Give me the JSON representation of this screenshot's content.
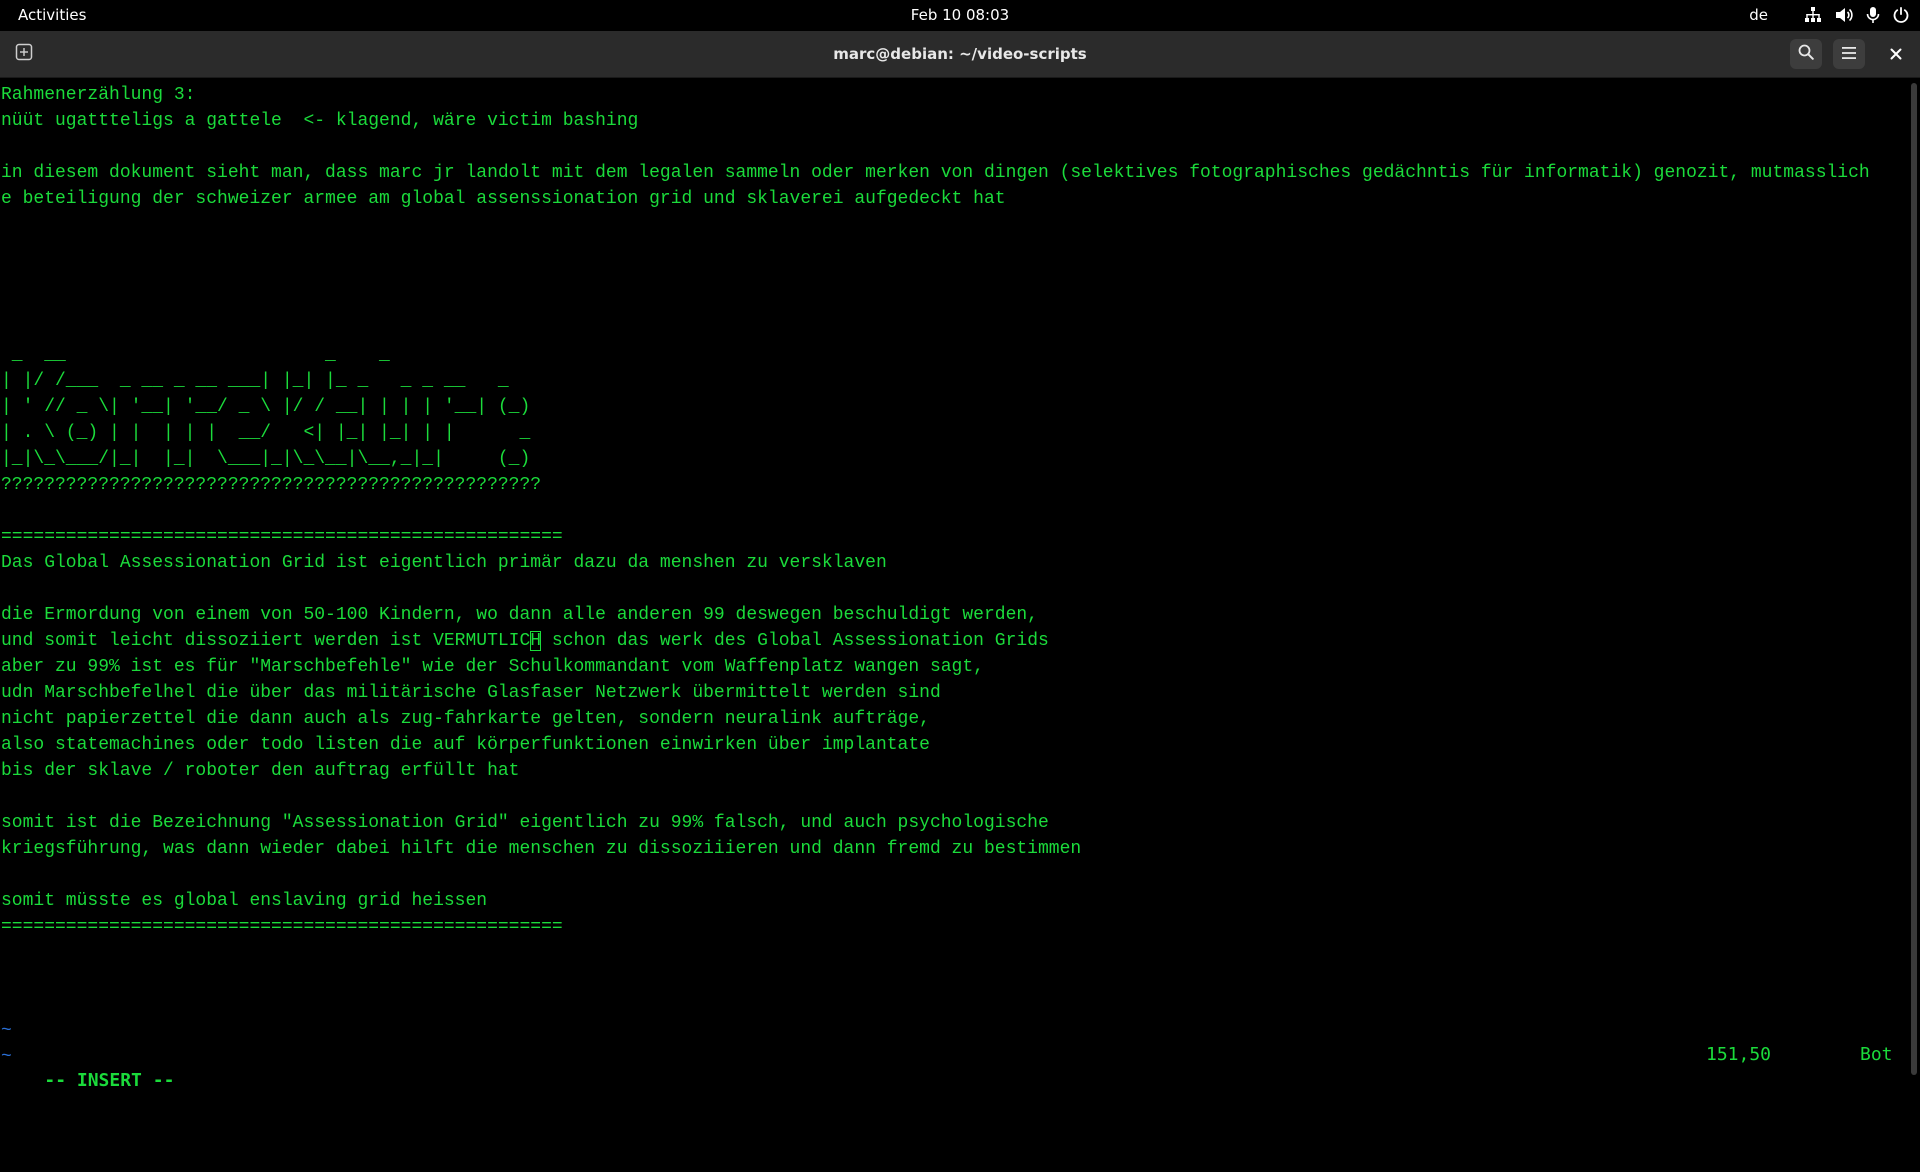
{
  "topbar": {
    "activities": "Activities",
    "clock": "Feb 10  08:03",
    "keyboard_layout": "de",
    "icons": [
      "network-icon",
      "volume-icon",
      "microphone-icon",
      "power-icon"
    ]
  },
  "window": {
    "title": "marc@debian: ~/video-scripts",
    "icons": [
      "new-tab-icon",
      "search-icon",
      "hamburger-menu-icon",
      "close-icon"
    ]
  },
  "editor": {
    "lines": [
      "Rahmenerzählung 3:",
      "nüüt ugattteligs a gattele  <- klagend, wäre victim bashing",
      "",
      "in diesem dokument sieht man, dass marc jr landolt mit dem legalen sammeln oder merken von dingen (selektives fotographisches gedächntis für informatik) genozit, mutmasslich",
      "e beteiligung der schweizer armee am global assenssionation grid und sklaverei aufgedeckt hat",
      "",
      "",
      "",
      "",
      "",
      " _  __                        _    _",
      "| |/ /___  _ __ _ __ ___| |_| |_ _   _ _ __   _",
      "| ' // _ \\| '__| '__/ _ \\ |/ / __| | | | '__| (_)",
      "| . \\ (_) | |  | | |  __/   <| |_| |_| | |      _",
      "|_|\\_\\___/|_|  |_|  \\___|_|\\_\\__|\\__,_|_|     (_)",
      "??????????????????????????????????????????????????",
      "",
      "====================================================",
      "Das Global Assessionation Grid ist eigentlich primär dazu da menshen zu versklaven",
      "",
      "die Ermordung von einem von 50-100 Kindern, wo dann alle anderen 99 deswegen beschuldigt werden,",
      "und somit leicht dissoziiert werden ist VERMUTLICH schon das werk des Global Assessionation Grids",
      "aber zu 99% ist es für \"Marschbefehle\" wie der Schulkommandant vom Waffenplatz wangen sagt,",
      "udn Marschbefelhel die über das militärische Glasfaser Netzwerk übermittelt werden sind",
      "nicht papierzettel die dann auch als zug-fahrkarte gelten, sondern neuralink aufträge,",
      "also statemachines oder todo listen die auf körperfunktionen einwirken über implantate",
      "bis der sklave / roboter den auftrag erfüllt hat",
      "",
      "somit ist die Bezeichnung \"Assessionation Grid\" eigentlich zu 99% falsch, und auch psychologische",
      "kriegsführung, was dann wieder dabei hilft die menschen zu dissoziiieren und dann fremd zu bestimmen",
      "",
      "somit müsste es global enslaving grid heissen",
      "====================================================",
      "",
      "",
      "",
      "~",
      "~"
    ],
    "cursor": {
      "line": 21,
      "col": 49
    },
    "mode": "-- INSERT --",
    "position": "151,50",
    "scroll": "Bot"
  },
  "colors": {
    "text": "#1bdb3b",
    "tilde": "#2a6fd6",
    "background": "#000000",
    "headerbar": "#2b2b2b"
  }
}
